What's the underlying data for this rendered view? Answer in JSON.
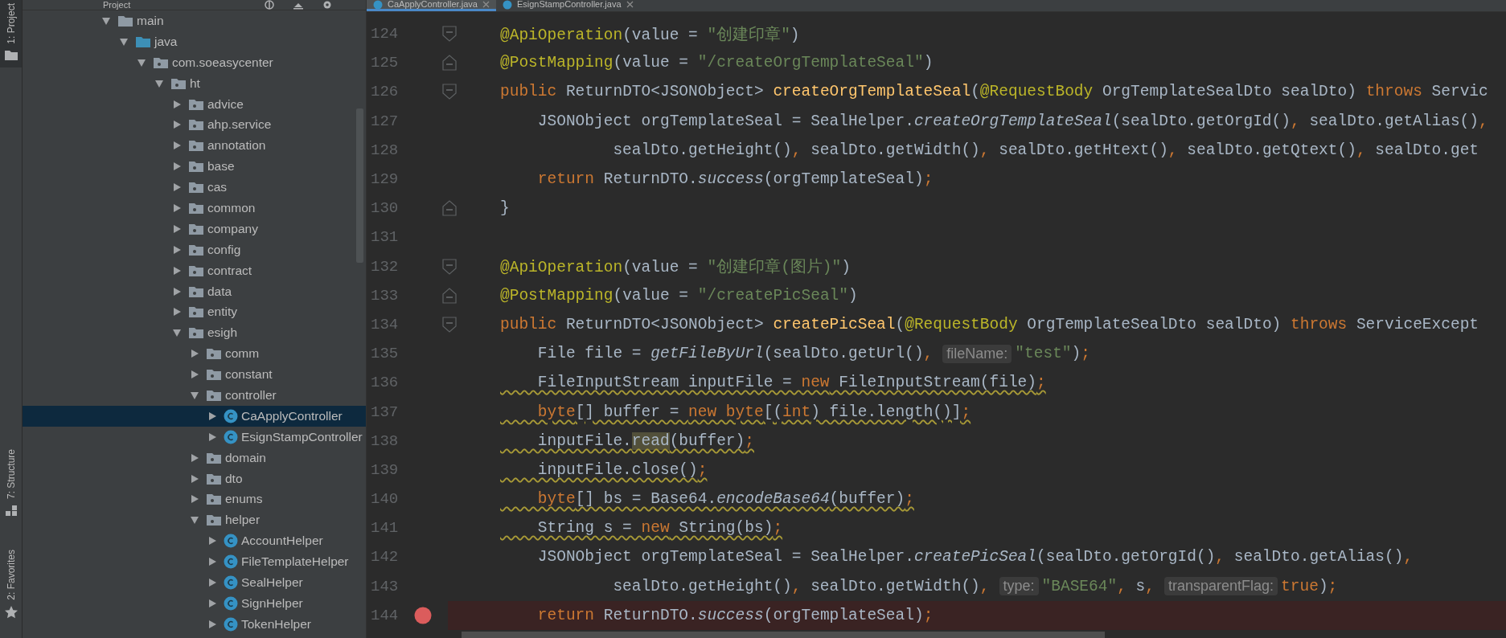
{
  "tool_stripe": [
    {
      "label": "1: Project",
      "selected": true
    },
    {
      "label": "7: Structure",
      "selected": false
    },
    {
      "label": "2: Favorites",
      "selected": false
    }
  ],
  "project_panel": {
    "title": "Project",
    "tree": [
      {
        "label": "main",
        "kind": "folder",
        "expanded": true,
        "selected": false,
        "children": [
          {
            "label": "java",
            "kind": "source-folder",
            "expanded": true,
            "selected": false,
            "children": [
              {
                "label": "com.soeasycenter",
                "kind": "package",
                "expanded": true,
                "selected": false,
                "children": [
                  {
                    "label": "ht",
                    "kind": "package",
                    "expanded": true,
                    "selected": false,
                    "children": [
                      {
                        "label": "advice",
                        "kind": "package",
                        "expanded": false,
                        "selected": false
                      },
                      {
                        "label": "ahp.service",
                        "kind": "package",
                        "expanded": false,
                        "selected": false
                      },
                      {
                        "label": "annotation",
                        "kind": "package",
                        "expanded": false,
                        "selected": false
                      },
                      {
                        "label": "base",
                        "kind": "package",
                        "expanded": false,
                        "selected": false
                      },
                      {
                        "label": "cas",
                        "kind": "package",
                        "expanded": false,
                        "selected": false
                      },
                      {
                        "label": "common",
                        "kind": "package",
                        "expanded": false,
                        "selected": false
                      },
                      {
                        "label": "company",
                        "kind": "package",
                        "expanded": false,
                        "selected": false
                      },
                      {
                        "label": "config",
                        "kind": "package",
                        "expanded": false,
                        "selected": false
                      },
                      {
                        "label": "contract",
                        "kind": "package",
                        "expanded": false,
                        "selected": false
                      },
                      {
                        "label": "data",
                        "kind": "package",
                        "expanded": false,
                        "selected": false
                      },
                      {
                        "label": "entity",
                        "kind": "package",
                        "expanded": false,
                        "selected": false
                      },
                      {
                        "label": "esigh",
                        "kind": "package",
                        "expanded": true,
                        "selected": false,
                        "children": [
                          {
                            "label": "comm",
                            "kind": "package",
                            "expanded": false,
                            "selected": false
                          },
                          {
                            "label": "constant",
                            "kind": "package",
                            "expanded": false,
                            "selected": false
                          },
                          {
                            "label": "controller",
                            "kind": "package",
                            "expanded": true,
                            "selected": false,
                            "children": [
                              {
                                "label": "CaApplyController",
                                "kind": "class",
                                "expanded": false,
                                "selected": true
                              },
                              {
                                "label": "EsignStampController",
                                "kind": "class",
                                "expanded": false,
                                "selected": false
                              }
                            ]
                          },
                          {
                            "label": "domain",
                            "kind": "package",
                            "expanded": false,
                            "selected": false
                          },
                          {
                            "label": "dto",
                            "kind": "package",
                            "expanded": false,
                            "selected": false
                          },
                          {
                            "label": "enums",
                            "kind": "package",
                            "expanded": false,
                            "selected": false
                          },
                          {
                            "label": "helper",
                            "kind": "package",
                            "expanded": true,
                            "selected": false,
                            "children": [
                              {
                                "label": "AccountHelper",
                                "kind": "class",
                                "expanded": false,
                                "selected": false
                              },
                              {
                                "label": "FileTemplateHelper",
                                "kind": "class",
                                "expanded": false,
                                "selected": false
                              },
                              {
                                "label": "SealHelper",
                                "kind": "class",
                                "expanded": false,
                                "selected": false
                              },
                              {
                                "label": "SignHelper",
                                "kind": "class",
                                "expanded": false,
                                "selected": false
                              },
                              {
                                "label": "TokenHelper",
                                "kind": "class",
                                "expanded": false,
                                "selected": false
                              }
                            ]
                          }
                        ]
                      }
                    ]
                  }
                ]
              }
            ]
          }
        ]
      }
    ]
  },
  "editor": {
    "tabs": [
      {
        "label": "CaApplyController.java",
        "selected": true
      },
      {
        "label": "EsignStampController.java",
        "selected": false
      }
    ],
    "lines": [
      {
        "number": "124",
        "fold": {
          "kind": "start"
        },
        "breakpoint": false,
        "warning": false,
        "tokens": [
          {
            "kind": "annotation",
            "text": "@ApiOperation"
          },
          {
            "kind": "plain",
            "text": "(value = "
          },
          {
            "kind": "string",
            "text": "\"创建印章\""
          },
          {
            "kind": "plain",
            "text": ")"
          }
        ]
      },
      {
        "number": "125",
        "fold": {
          "kind": "end"
        },
        "breakpoint": false,
        "warning": false,
        "tokens": [
          {
            "kind": "annotation",
            "text": "@PostMapping"
          },
          {
            "kind": "plain",
            "text": "(value = "
          },
          {
            "kind": "string",
            "text": "\"/createOrgTemplateSeal\""
          },
          {
            "kind": "plain",
            "text": ")"
          }
        ]
      },
      {
        "number": "126",
        "fold": {
          "kind": "start"
        },
        "breakpoint": false,
        "warning": false,
        "tokens": [
          {
            "kind": "keyword",
            "text": "public"
          },
          {
            "kind": "plain",
            "text": " ReturnDTO<JSONObject> "
          },
          {
            "kind": "declaration",
            "text": "createOrgTemplateSeal"
          },
          {
            "kind": "plain",
            "text": "("
          },
          {
            "kind": "annotation",
            "text": "@RequestBody"
          },
          {
            "kind": "plain",
            "text": " OrgTemplateSealDto sealDto) "
          },
          {
            "kind": "keyword",
            "text": "throws"
          },
          {
            "kind": "plain",
            "text": " Servic"
          }
        ]
      },
      {
        "number": "127",
        "breakpoint": false,
        "warning": false,
        "tokens": [
          {
            "kind": "plain",
            "text": "    JSONObject orgTemplateSeal = SealHelper."
          },
          {
            "kind": "static",
            "text": "createOrgTemplateSeal"
          },
          {
            "kind": "plain",
            "text": "(sealDto.getOrgId()"
          },
          {
            "kind": "punct",
            "text": ","
          },
          {
            "kind": "plain",
            "text": " sealDto.getAlias()"
          },
          {
            "kind": "punct",
            "text": ","
          }
        ]
      },
      {
        "number": "128",
        "breakpoint": false,
        "warning": false,
        "tokens": [
          {
            "kind": "plain",
            "text": "            sealDto.getHeight()"
          },
          {
            "kind": "punct",
            "text": ","
          },
          {
            "kind": "plain",
            "text": " sealDto.getWidth()"
          },
          {
            "kind": "punct",
            "text": ","
          },
          {
            "kind": "plain",
            "text": " sealDto.getHtext()"
          },
          {
            "kind": "punct",
            "text": ","
          },
          {
            "kind": "plain",
            "text": " sealDto.getQtext()"
          },
          {
            "kind": "punct",
            "text": ","
          },
          {
            "kind": "plain",
            "text": " sealDto.get"
          }
        ]
      },
      {
        "number": "129",
        "breakpoint": false,
        "warning": false,
        "tokens": [
          {
            "kind": "keyword",
            "text": "    return"
          },
          {
            "kind": "plain",
            "text": " ReturnDTO."
          },
          {
            "kind": "static",
            "text": "success"
          },
          {
            "kind": "plain",
            "text": "(orgTemplateSeal)"
          },
          {
            "kind": "punct",
            "text": ";"
          }
        ]
      },
      {
        "number": "130",
        "fold": {
          "kind": "end"
        },
        "breakpoint": false,
        "warning": false,
        "tokens": [
          {
            "kind": "plain",
            "text": "}"
          }
        ]
      },
      {
        "number": "131",
        "breakpoint": false
      },
      {
        "number": "132",
        "fold": {
          "kind": "start"
        },
        "breakpoint": false,
        "warning": false,
        "tokens": [
          {
            "kind": "annotation",
            "text": "@ApiOperation"
          },
          {
            "kind": "plain",
            "text": "(value = "
          },
          {
            "kind": "string",
            "text": "\"创建印章(图片)\""
          },
          {
            "kind": "plain",
            "text": ")"
          }
        ]
      },
      {
        "number": "133",
        "fold": {
          "kind": "end"
        },
        "breakpoint": false,
        "warning": false,
        "tokens": [
          {
            "kind": "annotation",
            "text": "@PostMapping"
          },
          {
            "kind": "plain",
            "text": "(value = "
          },
          {
            "kind": "string",
            "text": "\"/createPicSeal\""
          },
          {
            "kind": "plain",
            "text": ")"
          }
        ]
      },
      {
        "number": "134",
        "fold": {
          "kind": "start"
        },
        "breakpoint": false,
        "warning": false,
        "tokens": [
          {
            "kind": "keyword",
            "text": "public"
          },
          {
            "kind": "plain",
            "text": " ReturnDTO<JSONObject> "
          },
          {
            "kind": "declaration",
            "text": "createPicSeal"
          },
          {
            "kind": "plain",
            "text": "("
          },
          {
            "kind": "annotation",
            "text": "@RequestBody"
          },
          {
            "kind": "plain",
            "text": " OrgTemplateSealDto sealDto) "
          },
          {
            "kind": "keyword",
            "text": "throws"
          },
          {
            "kind": "plain",
            "text": " ServiceExcept"
          }
        ]
      },
      {
        "number": "135",
        "breakpoint": false,
        "warning": false,
        "tokens": [
          {
            "kind": "plain",
            "text": "    File file = "
          },
          {
            "kind": "static",
            "text": "getFileByUrl"
          },
          {
            "kind": "plain",
            "text": "(sealDto.getUrl()"
          },
          {
            "kind": "punct",
            "text": ","
          },
          {
            "kind": "hint",
            "text": "fileName:"
          },
          {
            "kind": "string",
            "text": "\"test\""
          },
          {
            "kind": "plain",
            "text": ")"
          },
          {
            "kind": "punct",
            "text": ";"
          }
        ]
      },
      {
        "number": "136",
        "breakpoint": false,
        "warning": true,
        "tokens": [
          {
            "kind": "plain",
            "text": "    FileInputStream inputFile = "
          },
          {
            "kind": "keyword",
            "text": "new"
          },
          {
            "kind": "plain",
            "text": " FileInputStream(file)"
          },
          {
            "kind": "punct",
            "text": ";"
          }
        ]
      },
      {
        "number": "137",
        "breakpoint": false,
        "warning": true,
        "tokens": [
          {
            "kind": "keyword",
            "text": "    byte"
          },
          {
            "kind": "plain",
            "text": "[] buffer = "
          },
          {
            "kind": "keyword",
            "text": "new byte"
          },
          {
            "kind": "plain",
            "text": "[("
          },
          {
            "kind": "keyword",
            "text": "int"
          },
          {
            "kind": "plain",
            "text": ") file.length()]"
          },
          {
            "kind": "punct",
            "text": ";"
          }
        ]
      },
      {
        "number": "138",
        "breakpoint": false,
        "warning": true,
        "tokens": [
          {
            "kind": "plain",
            "text": "    inputFile."
          },
          {
            "kind": "match",
            "text": "read"
          },
          {
            "kind": "plain",
            "text": "(buffer)"
          },
          {
            "kind": "punct",
            "text": ";"
          }
        ]
      },
      {
        "number": "139",
        "breakpoint": false,
        "warning": true,
        "tokens": [
          {
            "kind": "plain",
            "text": "    inputFile.close()"
          },
          {
            "kind": "punct",
            "text": ";"
          }
        ]
      },
      {
        "number": "140",
        "breakpoint": false,
        "warning": true,
        "tokens": [
          {
            "kind": "keyword",
            "text": "    byte"
          },
          {
            "kind": "plain",
            "text": "[] bs = Base64."
          },
          {
            "kind": "static",
            "text": "encodeBase64"
          },
          {
            "kind": "plain",
            "text": "(buffer)"
          },
          {
            "kind": "punct",
            "text": ";"
          }
        ]
      },
      {
        "number": "141",
        "breakpoint": false,
        "warning": true,
        "tokens": [
          {
            "kind": "plain",
            "text": "    String s = "
          },
          {
            "kind": "keyword",
            "text": "new"
          },
          {
            "kind": "plain",
            "text": " String(bs)"
          },
          {
            "kind": "punct",
            "text": ";"
          }
        ]
      },
      {
        "number": "142",
        "breakpoint": false,
        "warning": false,
        "tokens": [
          {
            "kind": "plain",
            "text": "    JSONObject orgTemplateSeal = SealHelper."
          },
          {
            "kind": "static",
            "text": "createPicSeal"
          },
          {
            "kind": "plain",
            "text": "(sealDto.getOrgId()"
          },
          {
            "kind": "punct",
            "text": ","
          },
          {
            "kind": "plain",
            "text": " sealDto.getAlias()"
          },
          {
            "kind": "punct",
            "text": ","
          }
        ]
      },
      {
        "number": "143",
        "breakpoint": false,
        "warning": false,
        "tokens": [
          {
            "kind": "plain",
            "text": "            sealDto.getHeight()"
          },
          {
            "kind": "punct",
            "text": ","
          },
          {
            "kind": "plain",
            "text": " sealDto.getWidth()"
          },
          {
            "kind": "punct",
            "text": ","
          },
          {
            "kind": "hint",
            "text": "type:"
          },
          {
            "kind": "string",
            "text": "\"BASE64\""
          },
          {
            "kind": "punct",
            "text": ","
          },
          {
            "kind": "plain",
            "text": " s"
          },
          {
            "kind": "punct",
            "text": ","
          },
          {
            "kind": "hint",
            "text": "transparentFlag:"
          },
          {
            "kind": "keyword",
            "text": "true"
          },
          {
            "kind": "plain",
            "text": ")"
          },
          {
            "kind": "punct",
            "text": ";"
          }
        ]
      },
      {
        "number": "144",
        "breakpoint": true,
        "warning": false,
        "tokens": [
          {
            "kind": "keyword",
            "text": "    return"
          },
          {
            "kind": "plain",
            "text": " ReturnDTO."
          },
          {
            "kind": "static",
            "text": "success"
          },
          {
            "kind": "plain",
            "text": "(orgTemplateSeal)"
          },
          {
            "kind": "punct",
            "text": ";"
          }
        ]
      }
    ]
  }
}
